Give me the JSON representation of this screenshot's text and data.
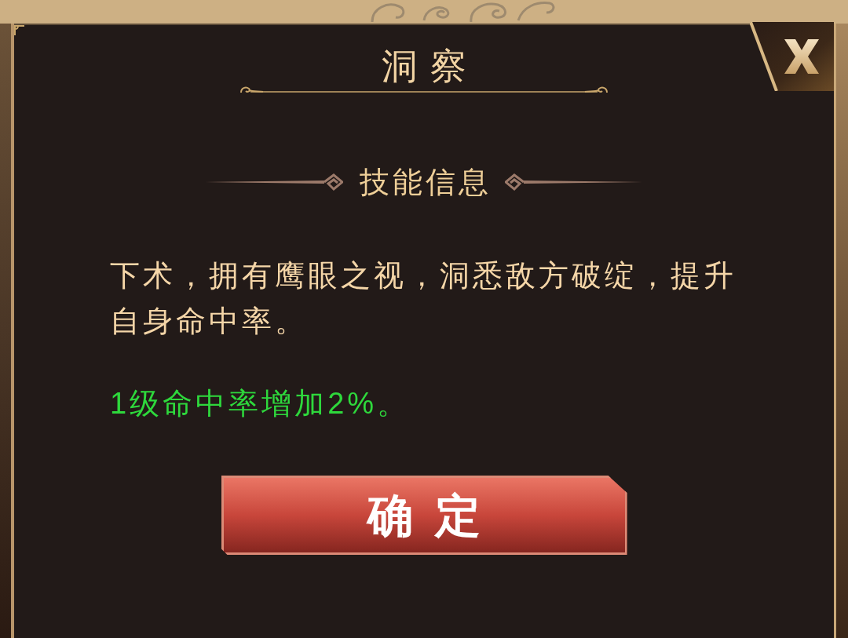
{
  "dialog": {
    "title": "洞察"
  },
  "section": {
    "heading": "技能信息"
  },
  "description": "下术，拥有鹰眼之视，洞悉敌方破绽，提升自身命中率。",
  "effect": "1级命中率增加2%。",
  "confirm_button": {
    "label": "确定"
  }
}
